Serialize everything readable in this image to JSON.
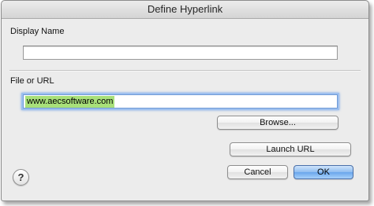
{
  "window": {
    "title": "Define Hyperlink"
  },
  "display_name": {
    "label": "Display Name",
    "value": ""
  },
  "file_or_url": {
    "label": "File or URL",
    "value": "www.aecsoftware.com"
  },
  "buttons": {
    "browse": "Browse...",
    "launch_url": "Launch URL",
    "cancel": "Cancel",
    "ok": "OK",
    "help": "?"
  },
  "colors": {
    "selection_highlight": "#a8e07a",
    "focus_ring": "#7aa6e6",
    "default_button": "#6aa6ec"
  }
}
